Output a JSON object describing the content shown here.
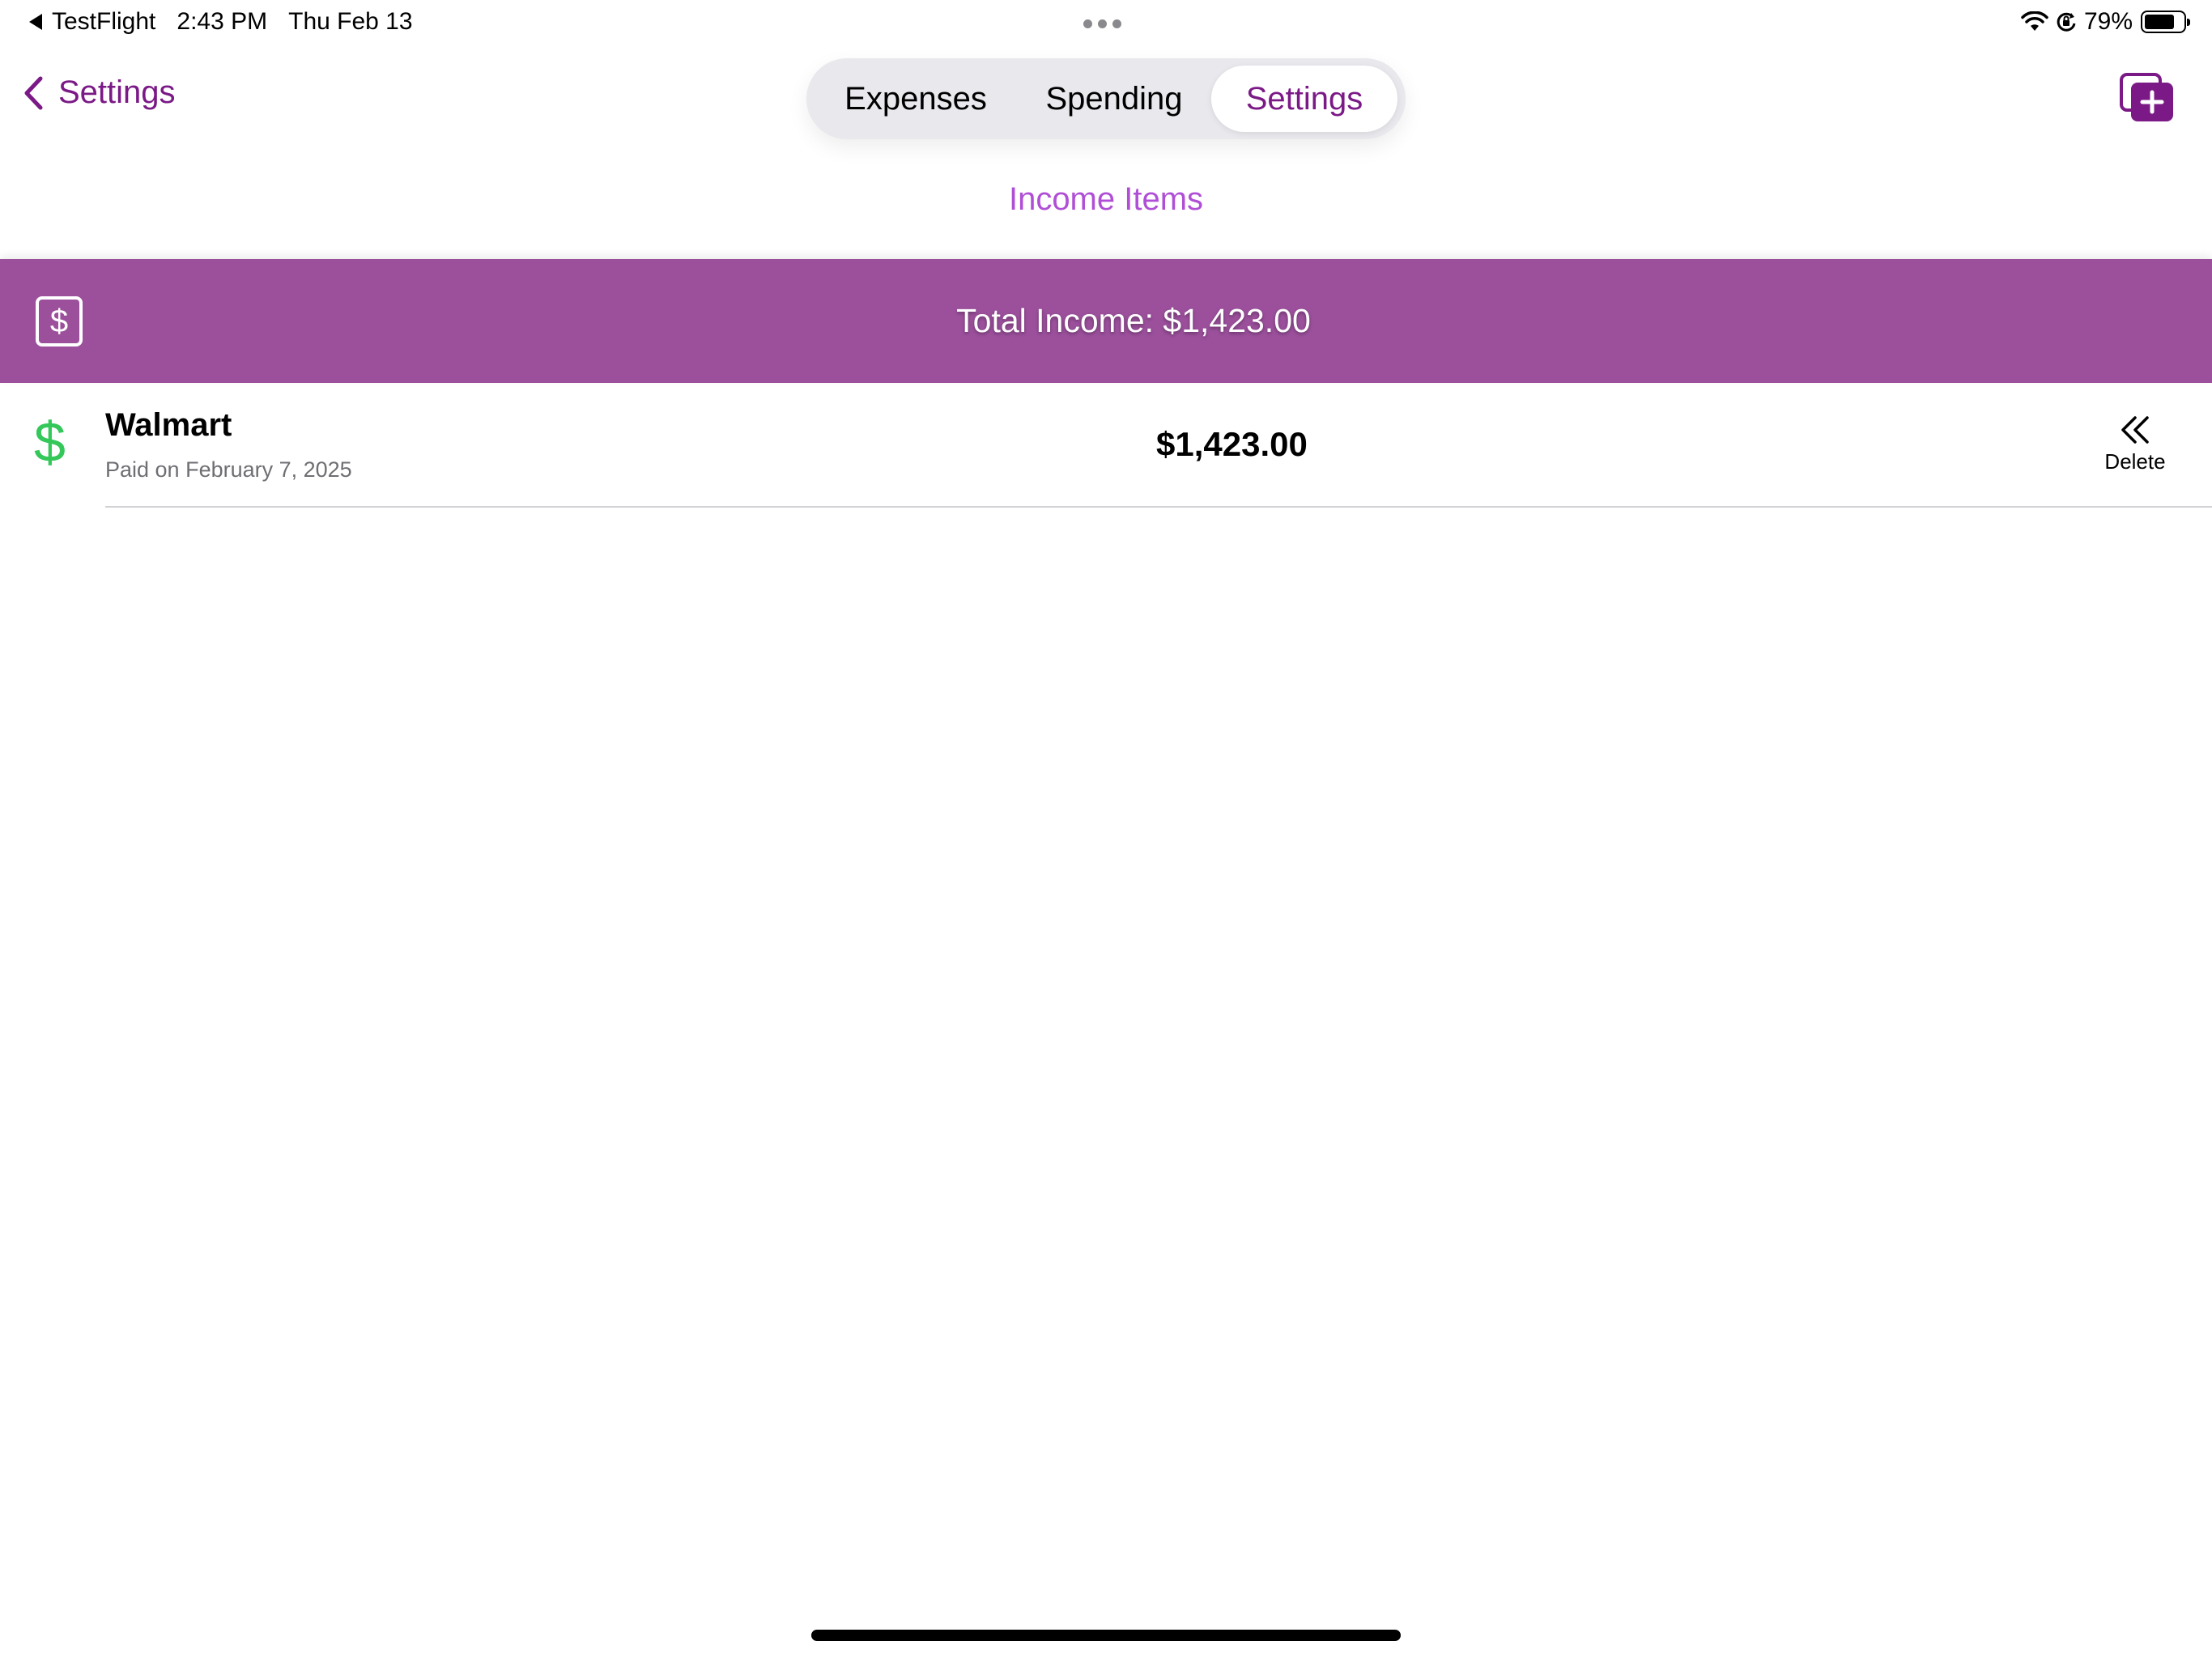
{
  "status_bar": {
    "back_app": "TestFlight",
    "time": "2:43 PM",
    "date": "Thu Feb 13",
    "battery_percent": "79%",
    "battery_level": 0.79
  },
  "nav": {
    "back_label": "Settings",
    "tabs": [
      {
        "label": "Expenses",
        "selected": false
      },
      {
        "label": "Spending",
        "selected": false
      },
      {
        "label": "Settings",
        "selected": true
      }
    ],
    "add_icon": "add-item-icon"
  },
  "page": {
    "title": "Income Items"
  },
  "total": {
    "label": "Total Income: $1,423.00",
    "icon": "dollar-square-icon"
  },
  "income_items": [
    {
      "name": "Walmart",
      "subtitle": "Paid on February 7, 2025",
      "amount": "$1,423.00",
      "icon": "dollar-icon",
      "delete_label": "Delete"
    }
  ],
  "colors": {
    "accent": "#7b1a86",
    "title": "#b04fd6",
    "banner": "#9c509c",
    "income_icon": "#34c759"
  }
}
